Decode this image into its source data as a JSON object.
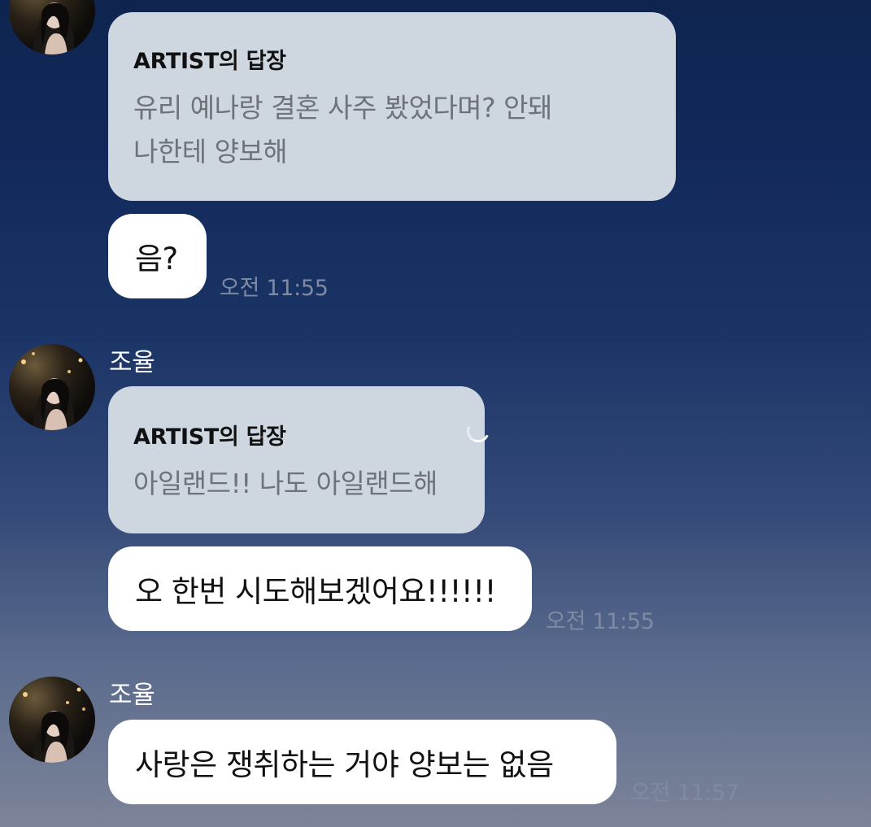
{
  "messages": [
    {
      "reply": {
        "title": "ARTIST의 답장",
        "line1": "유리 예나랑 결혼 사주 봤었다며? 안돼",
        "line2": "나한테 양보해"
      },
      "text": "음?",
      "time": "오전 11:55"
    },
    {
      "sender": "조율",
      "reply": {
        "title": "ARTIST의 답장",
        "line1": "아일랜드!! 나도 아일랜드해"
      },
      "text": "오 한번 시도해보겠어요!!!!!!",
      "time": "오전 11:55"
    },
    {
      "sender": "조율",
      "text": "사랑은 쟁취하는 거야 양보는 없음",
      "time": "오전 11:57"
    }
  ],
  "icons": {
    "avatar": "profile-photo",
    "loading": "loading-spinner-icon"
  },
  "colors": {
    "reply_bubble": "#ced6e0",
    "message_bubble": "#ffffff",
    "timestamp": "#7f8aa3"
  }
}
